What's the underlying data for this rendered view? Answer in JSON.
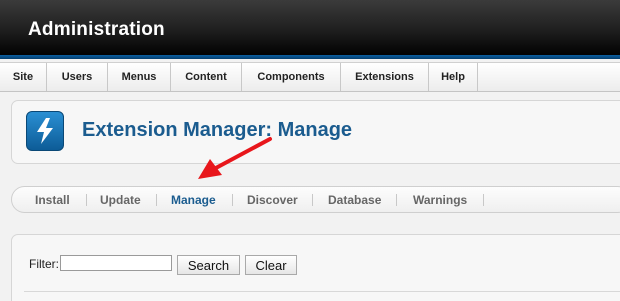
{
  "header": {
    "title": "Administration"
  },
  "menu": {
    "items": [
      {
        "label": "Site"
      },
      {
        "label": "Users"
      },
      {
        "label": "Menus"
      },
      {
        "label": "Content"
      },
      {
        "label": "Components"
      },
      {
        "label": "Extensions"
      },
      {
        "label": "Help"
      }
    ]
  },
  "toolbar": {
    "icon": "lightning-bolt-icon",
    "title": "Extension Manager: Manage"
  },
  "submenu": {
    "items": [
      {
        "label": "Install"
      },
      {
        "label": "Update"
      },
      {
        "label": "Manage",
        "active": true
      },
      {
        "label": "Discover"
      },
      {
        "label": "Database"
      },
      {
        "label": "Warnings"
      }
    ]
  },
  "filter": {
    "label": "Filter:",
    "value": "",
    "placeholder": "",
    "search_label": "Search",
    "clear_label": "Clear"
  },
  "colors": {
    "header_bg": "#1e1e1e",
    "accent_blue": "#0b5fa1",
    "title_blue": "#1b5c8f",
    "annotation_red": "#e8161b"
  }
}
